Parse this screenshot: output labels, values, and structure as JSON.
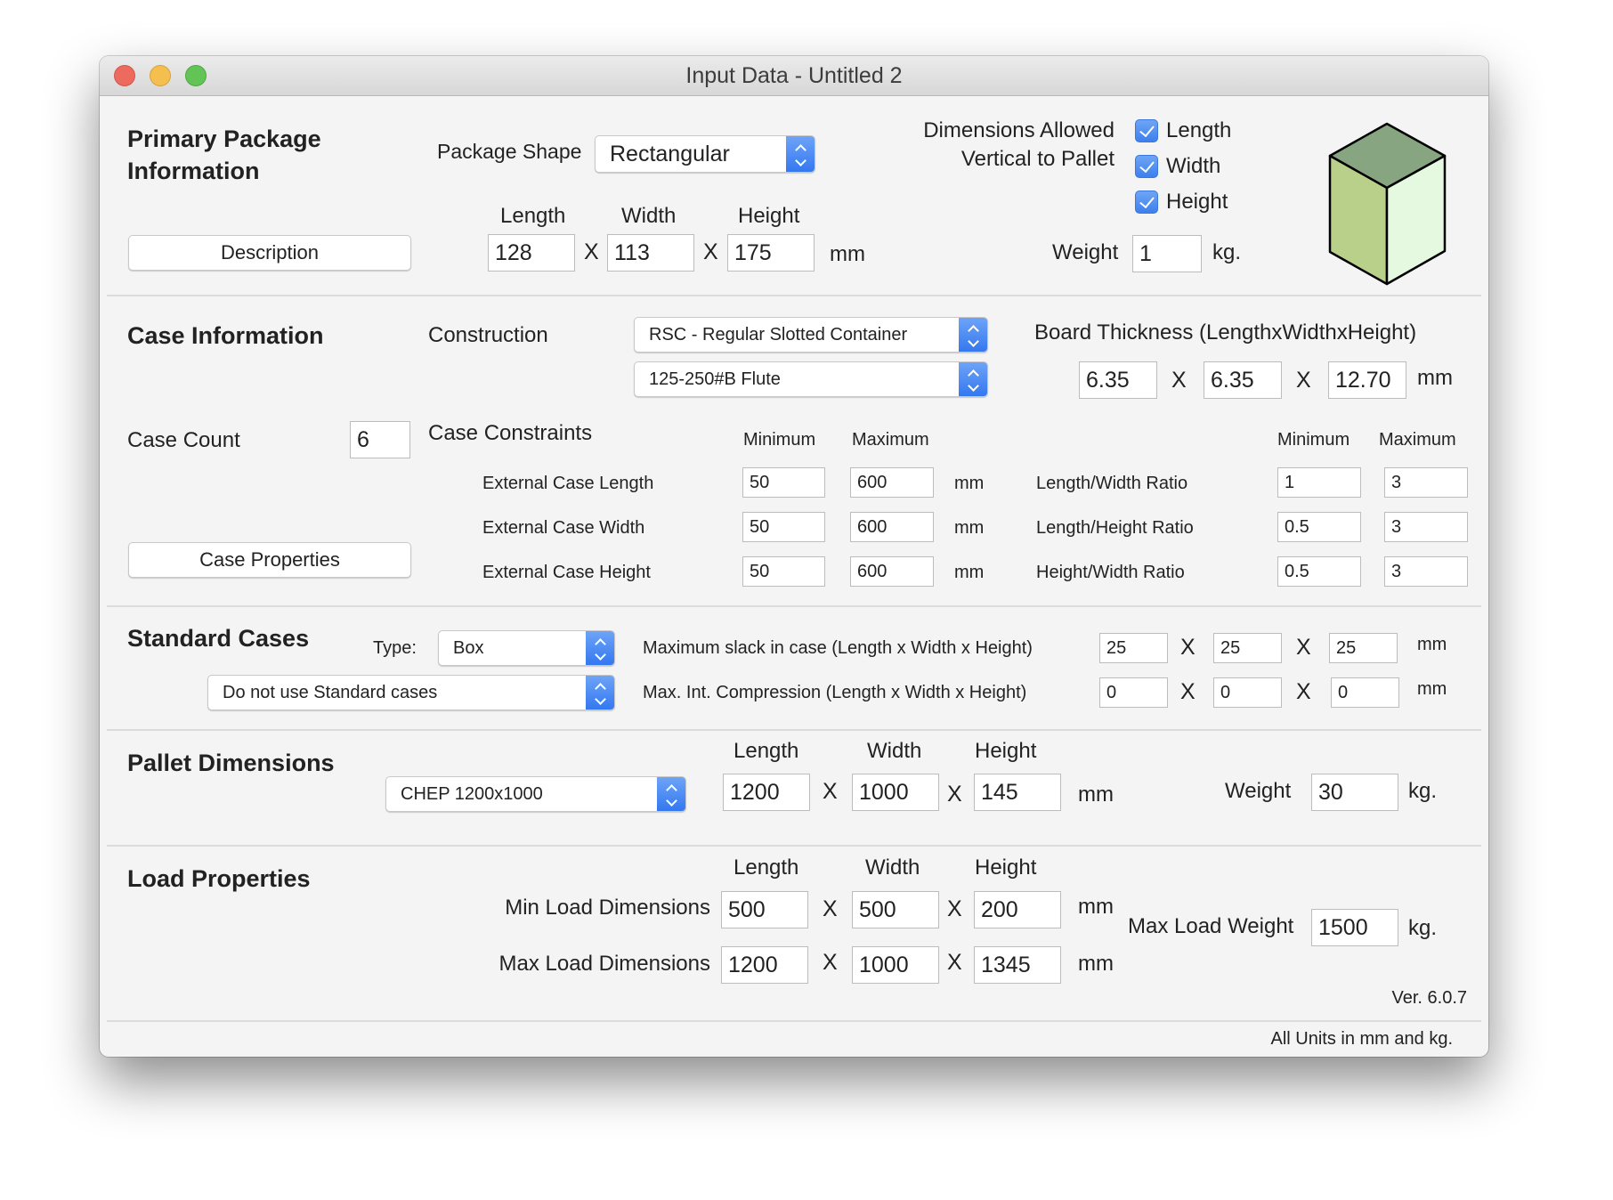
{
  "window": {
    "title": "Input Data - Untitled 2",
    "controls": [
      "close",
      "minimize",
      "zoom"
    ]
  },
  "primary": {
    "heading_line1": "Primary Package",
    "heading_line2": "Information",
    "package_shape_label": "Package Shape",
    "package_shape_value": "Rectangular",
    "description_button": "Description",
    "col_length": "Length",
    "col_width": "Width",
    "col_height": "Height",
    "length": "128",
    "width": "113",
    "height": "175",
    "times": "X",
    "unit_mm": "mm",
    "dims_allowed_line1": "Dimensions Allowed",
    "dims_allowed_line2": "Vertical to Pallet",
    "checkboxes": [
      {
        "label": "Length",
        "checked": true
      },
      {
        "label": "Width",
        "checked": true
      },
      {
        "label": "Height",
        "checked": true
      }
    ],
    "weight_label": "Weight",
    "weight": "1",
    "unit_kg": "kg.",
    "cube_icon": "package-cube-icon",
    "cube_colors": {
      "top": "#86a580",
      "left": "#b9d08a",
      "right": "#e4f9e0"
    }
  },
  "case": {
    "heading": "Case Information",
    "construction_label": "Construction",
    "construction_value": "RSC - Regular Slotted Container",
    "board_grade_value": "125-250#B Flute",
    "board_thickness_label": "Board Thickness (LengthxWidthxHeight)",
    "board_thickness": [
      "6.35",
      "6.35",
      "12.70"
    ],
    "case_count_label": "Case Count",
    "case_count": "6",
    "case_properties_button": "Case Properties",
    "constraints_label": "Case Constraints",
    "minimum": "Minimum",
    "maximum": "Maximum",
    "dimension_constraints": [
      {
        "label": "External Case Length",
        "min": "50",
        "max": "600",
        "unit": "mm"
      },
      {
        "label": "External Case Width",
        "min": "50",
        "max": "600",
        "unit": "mm"
      },
      {
        "label": "External Case Height",
        "min": "50",
        "max": "600",
        "unit": "mm"
      }
    ],
    "ratio_constraints": [
      {
        "label": "Length/Width Ratio",
        "min": "1",
        "max": "3"
      },
      {
        "label": "Length/Height Ratio",
        "min": "0.5",
        "max": "3"
      },
      {
        "label": "Height/Width Ratio",
        "min": "0.5",
        "max": "3"
      }
    ]
  },
  "standard": {
    "heading": "Standard Cases",
    "type_label": "Type:",
    "type_value": "Box",
    "usage_value": "Do not use Standard cases",
    "slack_label": "Maximum slack in case  (Length x Width x Height)",
    "slack": [
      "25",
      "25",
      "25"
    ],
    "compression_label": "Max. Int. Compression (Length x Width x Height)",
    "compression": [
      "0",
      "0",
      "0"
    ],
    "unit_mm": "mm"
  },
  "pallet": {
    "heading": "Pallet Dimensions",
    "pallet_type": "CHEP 1200x1000",
    "col_length": "Length",
    "col_width": "Width",
    "col_height": "Height",
    "length": "1200",
    "width": "1000",
    "height": "145",
    "unit_mm": "mm",
    "weight_label": "Weight",
    "weight": "30",
    "unit_kg": "kg."
  },
  "load": {
    "heading": "Load Properties",
    "col_length": "Length",
    "col_width": "Width",
    "col_height": "Height",
    "min_label": "Min Load Dimensions",
    "min": [
      "500",
      "500",
      "200"
    ],
    "max_label": "Max Load Dimensions",
    "max": [
      "1200",
      "1000",
      "1345"
    ],
    "unit_mm": "mm",
    "max_weight_label": "Max Load Weight",
    "max_weight": "1500",
    "unit_kg": "kg."
  },
  "footer": {
    "version": "Ver. 6.0.7",
    "units_note": "All Units in mm and kg."
  }
}
